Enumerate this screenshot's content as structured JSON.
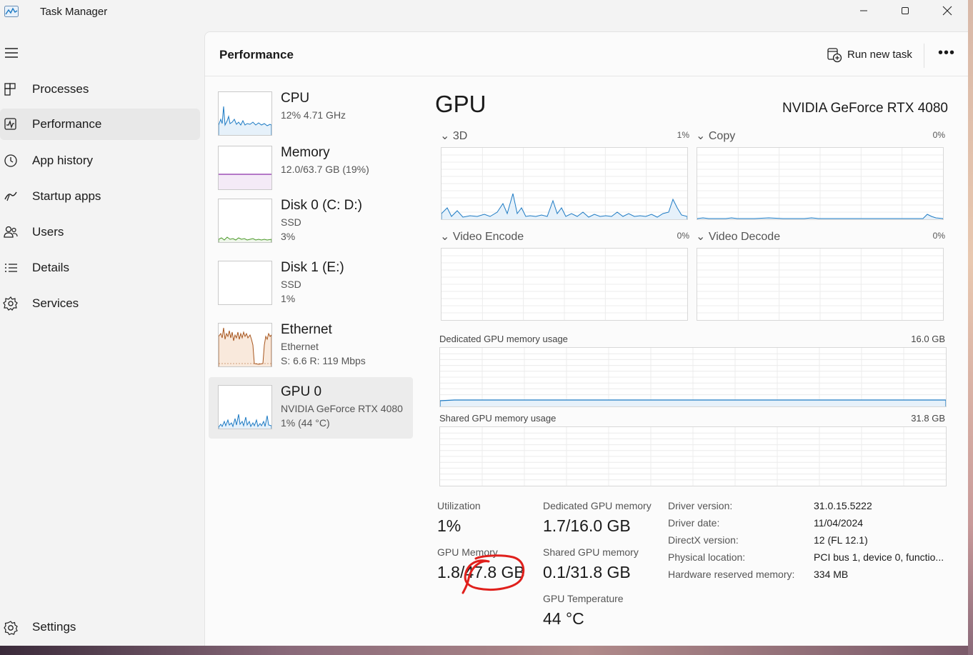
{
  "window": {
    "title": "Task Manager"
  },
  "nav": {
    "items": [
      {
        "label": "Processes",
        "icon": "processes-icon"
      },
      {
        "label": "Performance",
        "icon": "performance-icon",
        "active": true
      },
      {
        "label": "App history",
        "icon": "history-icon"
      },
      {
        "label": "Startup apps",
        "icon": "startup-icon"
      },
      {
        "label": "Users",
        "icon": "users-icon"
      },
      {
        "label": "Details",
        "icon": "details-icon"
      },
      {
        "label": "Services",
        "icon": "services-icon"
      }
    ],
    "settings_label": "Settings"
  },
  "header": {
    "title": "Performance",
    "run_new_task": "Run new task",
    "more": "•••"
  },
  "devices": [
    {
      "name": "CPU",
      "lines": [
        "12%  4.71 GHz"
      ],
      "color": "#1e7bc4"
    },
    {
      "name": "Memory",
      "lines": [
        "12.0/63.7 GB (19%)"
      ],
      "color": "#8b2fa8"
    },
    {
      "name": "Disk 0 (C: D:)",
      "lines": [
        "SSD",
        "3%"
      ],
      "color": "#4c9a2a"
    },
    {
      "name": "Disk 1 (E:)",
      "lines": [
        "SSD",
        "1%"
      ],
      "color": "#4c9a2a"
    },
    {
      "name": "Ethernet",
      "lines": [
        "Ethernet",
        "S: 6.6  R: 119 Mbps"
      ],
      "color": "#a7561e"
    },
    {
      "name": "GPU 0",
      "lines": [
        "NVIDIA GeForce RTX 4080",
        "1%  (44 °C)"
      ],
      "color": "#1e7bc4",
      "active": true
    }
  ],
  "gpu": {
    "title": "GPU",
    "model": "NVIDIA GeForce RTX 4080",
    "engines": [
      {
        "label": "3D",
        "pct": "1%"
      },
      {
        "label": "Copy",
        "pct": "0%"
      },
      {
        "label": "Video Encode",
        "pct": "0%"
      },
      {
        "label": "Video Decode",
        "pct": "0%"
      }
    ],
    "dedicated_mem": {
      "label": "Dedicated GPU memory usage",
      "max": "16.0 GB"
    },
    "shared_mem": {
      "label": "Shared GPU memory usage",
      "max": "31.8 GB"
    },
    "stats": {
      "utilization_label": "Utilization",
      "utilization": "1%",
      "gpu_memory_label": "GPU Memory",
      "gpu_memory": "1.8/47.8 GB",
      "dedicated_label": "Dedicated GPU memory",
      "dedicated": "1.7/16.0 GB",
      "shared_label": "Shared GPU memory",
      "shared": "0.1/31.8 GB",
      "temp_label": "GPU Temperature",
      "temp": "44 °C"
    },
    "details": [
      {
        "label": "Driver version:",
        "value": "31.0.15.5222"
      },
      {
        "label": "Driver date:",
        "value": "11/04/2024"
      },
      {
        "label": "DirectX version:",
        "value": "12 (FL 12.1)"
      },
      {
        "label": "Physical location:",
        "value": "PCI bus 1, device 0, functio..."
      },
      {
        "label": "Hardware reserved memory:",
        "value": "334 MB"
      }
    ]
  },
  "colors": {
    "accent": "#1e7bc4",
    "annotation": "#e0201c"
  }
}
